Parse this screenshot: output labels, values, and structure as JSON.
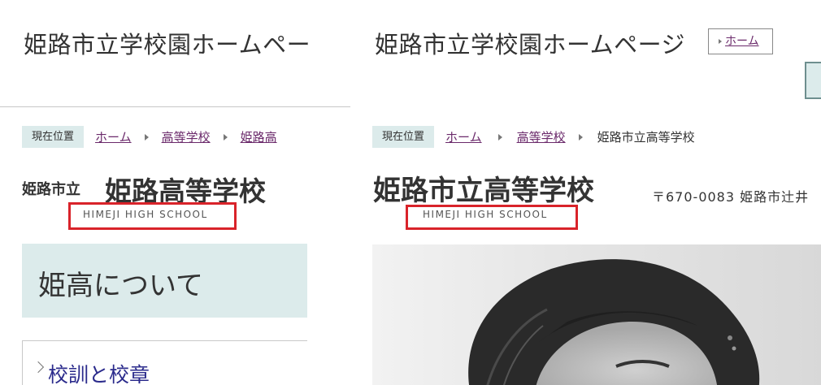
{
  "left": {
    "site_title": "姫路市立学校園ホームペー",
    "breadcrumb": {
      "current_label": "現在位置",
      "items": [
        "ホーム",
        "高等学校",
        "姫路高"
      ]
    },
    "school_prefix": "姫路市立",
    "school_name": "姫路高等学校",
    "school_name_en": "HIMEJI HIGH SCHOOL",
    "about_title": "姫高について",
    "subnav_item": "校訓と校章"
  },
  "right": {
    "site_title": "姫路市立学校園ホームページ",
    "home_button": "ホーム",
    "breadcrumb": {
      "current_label": "現在位置",
      "items": [
        "ホーム",
        "高等学校"
      ],
      "current": "姫路市立高等学校"
    },
    "school_name": "姫路市立高等学校",
    "school_name_en": "HIMEJI HIGH SCHOOL",
    "address": "〒670-0083 姫路市辻井"
  },
  "colors": {
    "accent_bg": "#dcebeb",
    "link": "#6b2a6b",
    "highlight_box": "#d9232a",
    "subnav_text": "#2b2b8c"
  },
  "icons": [
    "breadcrumb-separator-icon",
    "chevron-right-icon",
    "home-triangle-icon"
  ]
}
